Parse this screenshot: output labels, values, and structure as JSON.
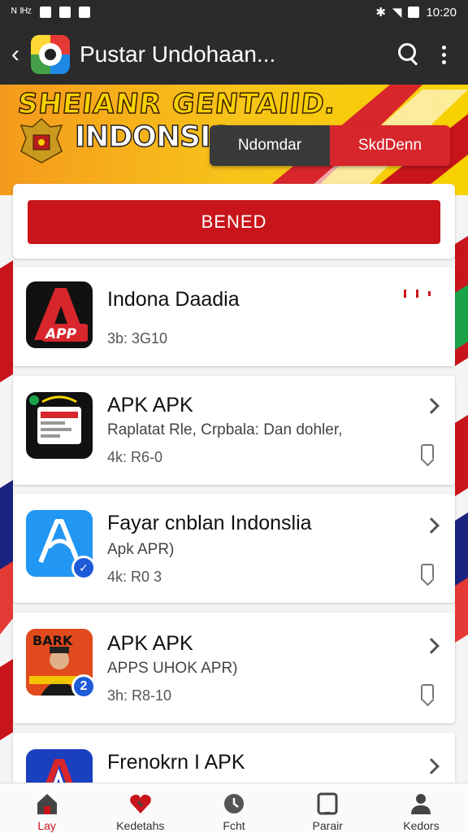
{
  "status_bar": {
    "left": "ᴺ ᴵᴴᶻ",
    "time": "10:20"
  },
  "app_bar": {
    "title": "Pustar Undohaan..."
  },
  "banner": {
    "headline": "SHEIANR GENTAIID.",
    "country": "INDONSIA",
    "tab_left": "Ndomdar",
    "tab_right": "SkdDenn"
  },
  "panel": {
    "button_label": "BENED"
  },
  "apps": [
    {
      "title": "Indona Daadia",
      "subtitle": "",
      "meta": "3b: 3G10",
      "icon": "app-a-logo-icon"
    },
    {
      "title": "APK APK",
      "subtitle": "Raplatat Rle, Crpbala: Dan dohler,",
      "meta": "4k: R6-0",
      "icon": "phone-screenshot-icon"
    },
    {
      "title": "Fayar cnblan Indonslia",
      "subtitle": "Apk APR)",
      "meta": "4k: R0 3",
      "icon": "blue-a-logo-icon"
    },
    {
      "title": "APK APK",
      "subtitle": "APPS UHOK APR)",
      "meta": "3h: R8-10",
      "icon": "person-poster-icon"
    },
    {
      "title": "Frenokrn I APK",
      "subtitle": "",
      "meta": "",
      "icon": "red-a-logo-icon"
    }
  ],
  "icon_texts": {
    "app1": "APP",
    "app4": "BARK",
    "app4_badge": "2"
  },
  "bottom_nav": [
    {
      "label": "Lay",
      "icon": "home-icon",
      "active": true
    },
    {
      "label": "Kedetahs",
      "icon": "heart-icon",
      "active": false
    },
    {
      "label": "Fcht",
      "icon": "clock-icon",
      "active": false
    },
    {
      "label": "Parair",
      "icon": "tablet-icon",
      "active": false
    },
    {
      "label": "Kedors",
      "icon": "person-icon",
      "active": false
    }
  ],
  "colors": {
    "accent_red": "#c8151b",
    "app_bar": "#2b2b2b",
    "banner_yellow": "#f7d200"
  }
}
